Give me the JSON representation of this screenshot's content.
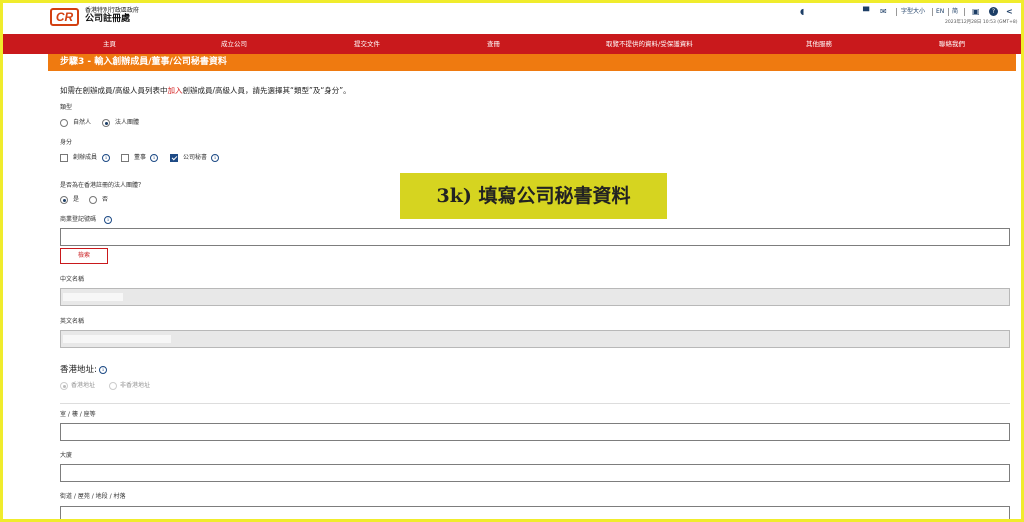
{
  "header": {
    "logo_text": "CR",
    "org_line1": "香港特別行政區政府",
    "org_line2": "公司註冊處",
    "headset_icon": "◖",
    "cart_icon": "▀",
    "mail_icon": "✉",
    "font_size_label": "字型大小",
    "lang_en": "EN",
    "lang_sc": "简",
    "print_icon": "▣",
    "help_icon": "?",
    "share_icon": "<",
    "datetime": "2023年12月28日 10:53 (GMT+8)"
  },
  "nav": {
    "items": [
      "主頁",
      "成立公司",
      "提交文件",
      "查冊",
      "取覽不提供的資料/受保護資料",
      "其他服務",
      "聯絡我們"
    ]
  },
  "step": {
    "title": "步驟3 - 輸入創辦成員/董事/公司秘書資料"
  },
  "instruction": {
    "prefix": "如需在創辦成員/高級人員列表中",
    "highlight": "加入",
    "suffix": "創辦成員/高級人員，請先選擇其“類型”及“身分”。"
  },
  "type": {
    "label": "類型",
    "options": [
      "自然人",
      "法人團體"
    ],
    "selected": "法人團體"
  },
  "identity": {
    "label": "身分",
    "options": [
      "創辦成員",
      "董事",
      "公司秘書"
    ],
    "checked": [
      "公司秘書"
    ]
  },
  "registered_hk": {
    "label": "是否為在香港註冊的法人團體？",
    "options": [
      "是",
      "否"
    ],
    "selected": "是"
  },
  "brn": {
    "label": "商業登記號碼",
    "value": "",
    "search_label": "檢索"
  },
  "chinese_name": {
    "label": "中文名稱",
    "value": ""
  },
  "english_name": {
    "label": "英文名稱",
    "value": ""
  },
  "address": {
    "label": "香港地址:",
    "options": [
      "香港地址",
      "非香港地址"
    ],
    "selected": "香港地址"
  },
  "room_floor": {
    "label": "室 / 樓 / 座等",
    "value": ""
  },
  "building": {
    "label": "大廈",
    "value": ""
  },
  "street": {
    "label": "街道 / 屋苑 / 地段 / 村落",
    "value": ""
  },
  "overlay": {
    "text": "3k) 填寫公司秘書資料"
  },
  "colors": {
    "nav_red": "#c9191c",
    "step_orange": "#ef7a10",
    "overlay_yellow": "#d6d420",
    "border_yellow": "#f0ec2c"
  }
}
